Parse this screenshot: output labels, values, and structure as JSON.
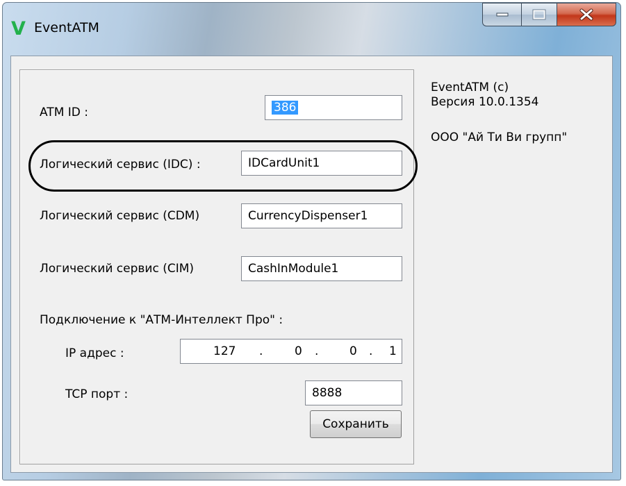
{
  "window": {
    "title": "EventATM",
    "icon": "V"
  },
  "form": {
    "atm_id_label": "ATM ID :",
    "atm_id_value": "386",
    "idc_label": "Логический сервис (IDC) :",
    "idc_value": "IDCardUnit1",
    "cdm_label": "Логический сервис (CDM)",
    "cdm_value": "CurrencyDispenser1",
    "cim_label": "Логический сервис (CIM)",
    "cim_value": "CashInModule1",
    "connection_label": "Подключение к \"АТМ-Интеллект Про\" :",
    "ip_label": "IP адрес :",
    "ip_octets": [
      "127",
      ".",
      "0",
      ".",
      "0",
      ".",
      "1"
    ],
    "tcp_label": "TCP порт :",
    "tcp_value": "8888",
    "save_label": "Сохранить"
  },
  "info": {
    "product": "EventATM (c)",
    "version": "Версия 10.0.1354",
    "company": "ООО \"Ай Ти Ви групп\""
  },
  "colors": {
    "icon_green": "#22b14c",
    "selection": "#3399ff",
    "close_button": "#c2361a"
  }
}
